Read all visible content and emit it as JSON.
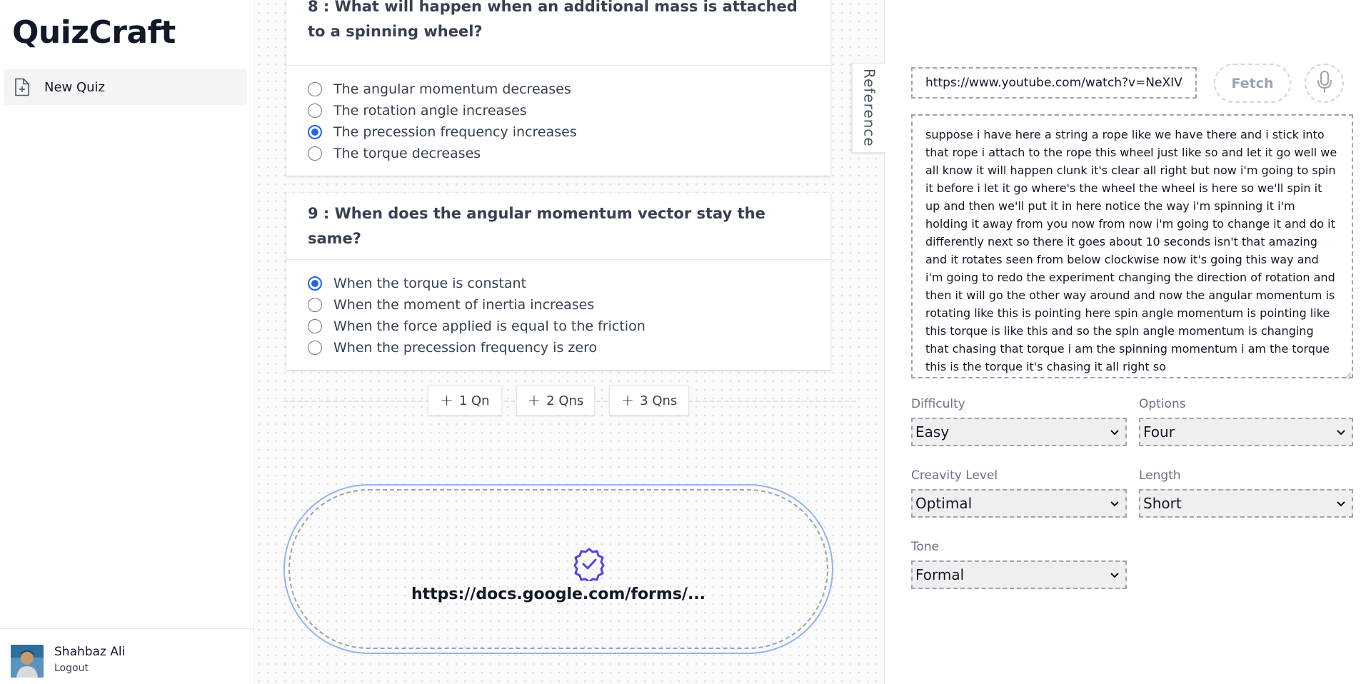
{
  "app": {
    "title": "QuizCraft"
  },
  "sidebar": {
    "items": [
      {
        "label": "New Quiz",
        "icon": "file-plus-icon"
      }
    ],
    "user": {
      "name": "Shahbaz Ali",
      "logout_label": "Logout"
    }
  },
  "questions": [
    {
      "number": "8",
      "title": "8 : What will happen when an additional mass is attached to a spinning wheel?",
      "options": [
        {
          "text": "The angular momentum decreases",
          "selected": false
        },
        {
          "text": "The rotation angle increases",
          "selected": false
        },
        {
          "text": "The precession frequency increases",
          "selected": true
        },
        {
          "text": "The torque decreases",
          "selected": false
        }
      ]
    },
    {
      "number": "9",
      "title": "9 : When does the angular momentum vector stay the same?",
      "options": [
        {
          "text": "When the torque is constant",
          "selected": true
        },
        {
          "text": "When the moment of inertia increases",
          "selected": false
        },
        {
          "text": "When the force applied is equal to the friction",
          "selected": false
        },
        {
          "text": "When the precession frequency is zero",
          "selected": false
        }
      ]
    }
  ],
  "add_buttons": {
    "one": "1 Qn",
    "two": "2 Qns",
    "three": "3 Qns"
  },
  "form_link": {
    "text": "https://docs.google.com/forms/...",
    "icon": "badge-check-icon"
  },
  "reference_tab": {
    "label": "Reference"
  },
  "reference": {
    "url_value": "https://www.youtube.com/watch?v=NeXIV-w",
    "fetch_label": "Fetch",
    "mic_icon": "microphone-icon",
    "transcript": "suppose i have here a string a rope like we have there and i stick into that rope i attach to the rope this wheel just like so and let it go well we all know it will happen clunk it's clear all right but now i'm going to spin it before i let it go where's the wheel the wheel is here so we'll spin it up and then we'll put it in here notice the way i'm spinning it i'm holding it away from you now from now i'm going to change it and do it differently next so  there it goes about 10 seconds isn't that amazing and it rotates seen from below clockwise now it's going this way and i'm going to redo the experiment changing the direction of rotation and then it will go the other way around and now the angular momentum is rotating like this is pointing here spin angle momentum is pointing like this torque is like this and so the spin angle momentum is changing that chasing that torque i am the spinning momentum i am the torque this is the torque it's chasing it all right so",
    "fields": {
      "difficulty": {
        "label": "Difficulty",
        "value": "Easy"
      },
      "options": {
        "label": "Options",
        "value": "Four"
      },
      "creativity": {
        "label": "Creavity Level",
        "value": "Optimal"
      },
      "length": {
        "label": "Length",
        "value": "Short"
      },
      "tone": {
        "label": "Tone",
        "value": "Formal"
      }
    }
  },
  "colors": {
    "accent": "#2563eb",
    "badge": "#4f46e5",
    "pill_border": "#93b4f0"
  }
}
